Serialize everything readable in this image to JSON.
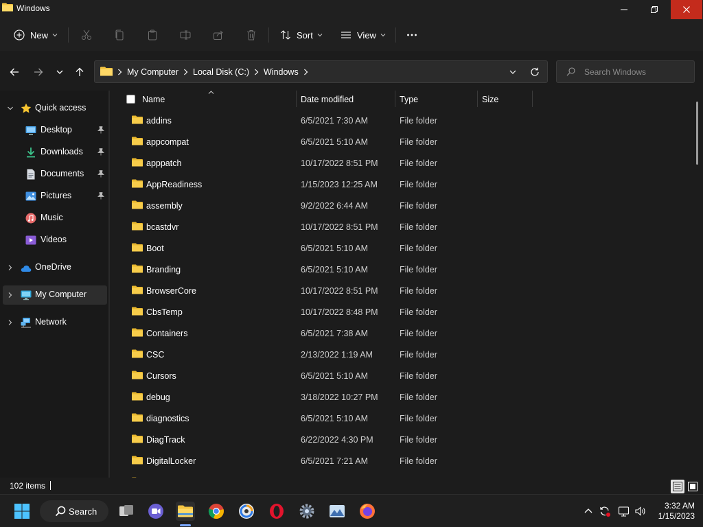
{
  "window": {
    "title": "Windows"
  },
  "toolbar": {
    "new_label": "New",
    "sort_label": "Sort",
    "view_label": "View"
  },
  "address": {
    "crumbs": [
      "My Computer",
      "Local Disk (C:)",
      "Windows"
    ]
  },
  "search": {
    "placeholder": "Search Windows"
  },
  "sidebar": {
    "quick_access": "Quick access",
    "items": [
      {
        "label": "Desktop",
        "icon": "desktop-icon",
        "pinned": true
      },
      {
        "label": "Downloads",
        "icon": "download-icon",
        "pinned": true
      },
      {
        "label": "Documents",
        "icon": "document-icon",
        "pinned": true
      },
      {
        "label": "Pictures",
        "icon": "pictures-icon",
        "pinned": true
      },
      {
        "label": "Music",
        "icon": "music-icon",
        "pinned": false
      },
      {
        "label": "Videos",
        "icon": "videos-icon",
        "pinned": false
      }
    ],
    "onedrive": "OneDrive",
    "my_computer": "My Computer",
    "network": "Network"
  },
  "columns": {
    "name": "Name",
    "date": "Date modified",
    "type": "Type",
    "size": "Size"
  },
  "files": [
    {
      "name": "addins",
      "date": "6/5/2021 7:30 AM",
      "type": "File folder"
    },
    {
      "name": "appcompat",
      "date": "6/5/2021 5:10 AM",
      "type": "File folder"
    },
    {
      "name": "apppatch",
      "date": "10/17/2022 8:51 PM",
      "type": "File folder"
    },
    {
      "name": "AppReadiness",
      "date": "1/15/2023 12:25 AM",
      "type": "File folder"
    },
    {
      "name": "assembly",
      "date": "9/2/2022 6:44 AM",
      "type": "File folder"
    },
    {
      "name": "bcastdvr",
      "date": "10/17/2022 8:51 PM",
      "type": "File folder"
    },
    {
      "name": "Boot",
      "date": "6/5/2021 5:10 AM",
      "type": "File folder"
    },
    {
      "name": "Branding",
      "date": "6/5/2021 5:10 AM",
      "type": "File folder"
    },
    {
      "name": "BrowserCore",
      "date": "10/17/2022 8:51 PM",
      "type": "File folder"
    },
    {
      "name": "CbsTemp",
      "date": "10/17/2022 8:48 PM",
      "type": "File folder"
    },
    {
      "name": "Containers",
      "date": "6/5/2021 7:38 AM",
      "type": "File folder"
    },
    {
      "name": "CSC",
      "date": "2/13/2022 1:19 AM",
      "type": "File folder"
    },
    {
      "name": "Cursors",
      "date": "6/5/2021 5:10 AM",
      "type": "File folder"
    },
    {
      "name": "debug",
      "date": "3/18/2022 10:27 PM",
      "type": "File folder"
    },
    {
      "name": "diagnostics",
      "date": "6/5/2021 5:10 AM",
      "type": "File folder"
    },
    {
      "name": "DiagTrack",
      "date": "6/22/2022 4:30 PM",
      "type": "File folder"
    },
    {
      "name": "DigitalLocker",
      "date": "6/5/2021 7:21 AM",
      "type": "File folder"
    }
  ],
  "status": {
    "item_count": "102 items"
  },
  "taskbar": {
    "search_label": "Search"
  },
  "clock": {
    "time": "3:32 AM",
    "date": "1/15/2023"
  },
  "colors": {
    "folder": "#f5c542",
    "close_button": "#c42b1c",
    "accent": "#7aa7ff"
  }
}
